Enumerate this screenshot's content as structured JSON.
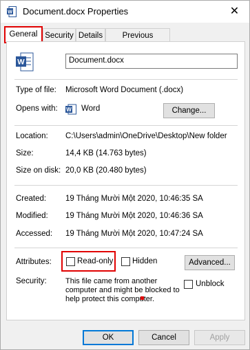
{
  "window": {
    "title": "Document.docx Properties",
    "close_glyph": "✕",
    "icon": "word-doc-icon"
  },
  "tabs": [
    {
      "label": "General",
      "selected": true
    },
    {
      "label": "Security"
    },
    {
      "label": "Details"
    },
    {
      "label": "Previous Versions"
    }
  ],
  "file": {
    "name": "Document.docx",
    "type_label": "Type of file:",
    "type_value": "Microsoft Word Document (.docx)",
    "opens_label": "Opens with:",
    "opens_value": "Word",
    "change_button": "Change...",
    "location_label": "Location:",
    "location_value": "C:\\Users\\admin\\OneDrive\\Desktop\\New folder",
    "size_label": "Size:",
    "size_value": "14,4 KB (14.763 bytes)",
    "size_on_disk_label": "Size on disk:",
    "size_on_disk_value": "20,0 KB (20.480 bytes)",
    "created_label": "Created:",
    "created_value": "19 Tháng Mười Một 2020, 10:46:35 SA",
    "modified_label": "Modified:",
    "modified_value": "19 Tháng Mười Một 2020, 10:46:36 SA",
    "accessed_label": "Accessed:",
    "accessed_value": "19 Tháng Mười Một 2020, 10:47:24 SA"
  },
  "attributes": {
    "label": "Attributes:",
    "readonly": "Read-only",
    "hidden": "Hidden",
    "advanced_button": "Advanced..."
  },
  "security": {
    "label": "Security:",
    "line1": "This file came from another",
    "line2": "computer and might be blocked to",
    "line3": "help protect this computer.",
    "unblock": "Unblock"
  },
  "footer": {
    "ok": "OK",
    "cancel": "Cancel",
    "apply": "Apply"
  },
  "colors": {
    "highlight": "#e00000",
    "word_blue": "#2b579a"
  }
}
